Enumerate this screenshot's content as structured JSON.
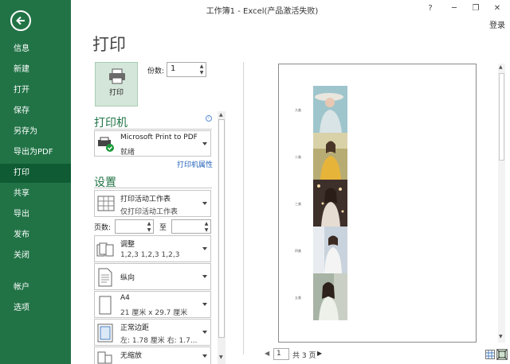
{
  "window": {
    "title": "工作簿1 - Excel(产品激活失败)",
    "help": "?",
    "minimize": "─",
    "restore": "❐",
    "close": "✕",
    "login": "登录"
  },
  "sidebar": {
    "items": [
      {
        "label": "信息"
      },
      {
        "label": "新建"
      },
      {
        "label": "打开"
      },
      {
        "label": "保存"
      },
      {
        "label": "另存为"
      },
      {
        "label": "导出为PDF"
      },
      {
        "label": "打印"
      },
      {
        "label": "共享"
      },
      {
        "label": "导出"
      },
      {
        "label": "发布"
      },
      {
        "label": "关闭"
      },
      {
        "label": "帐户"
      },
      {
        "label": "选项"
      }
    ]
  },
  "print": {
    "title": "打印",
    "button_label": "打印",
    "copies_label": "份数:",
    "copies_value": "1"
  },
  "printer": {
    "section_title": "打印机",
    "name": "Microsoft Print to PDF",
    "status": "就绪",
    "properties_link": "打印机属性"
  },
  "settings": {
    "section_title": "设置",
    "what": {
      "main": "打印活动工作表",
      "sub": "仅打印活动工作表"
    },
    "pages_label": "页数:",
    "pages_to": "至",
    "collate": {
      "main": "调整",
      "sub": "1,2,3    1,2,3    1,2,3"
    },
    "orientation": {
      "main": "纵向"
    },
    "paper": {
      "main": "A4",
      "sub": "21 厘米 x 29.7 厘米"
    },
    "margins": {
      "main": "正常边距",
      "sub": "左: 1.78 厘米    右: 1.7..."
    },
    "scaling": {
      "main": "无缩放"
    }
  },
  "preview": {
    "captions": [
      "大美",
      "二美",
      "三美",
      "四美",
      "五美"
    ]
  },
  "pager": {
    "current": "1",
    "total": "共 3 页"
  },
  "colors": {
    "accent": "#217346",
    "active_nav": "#0f5b33"
  }
}
